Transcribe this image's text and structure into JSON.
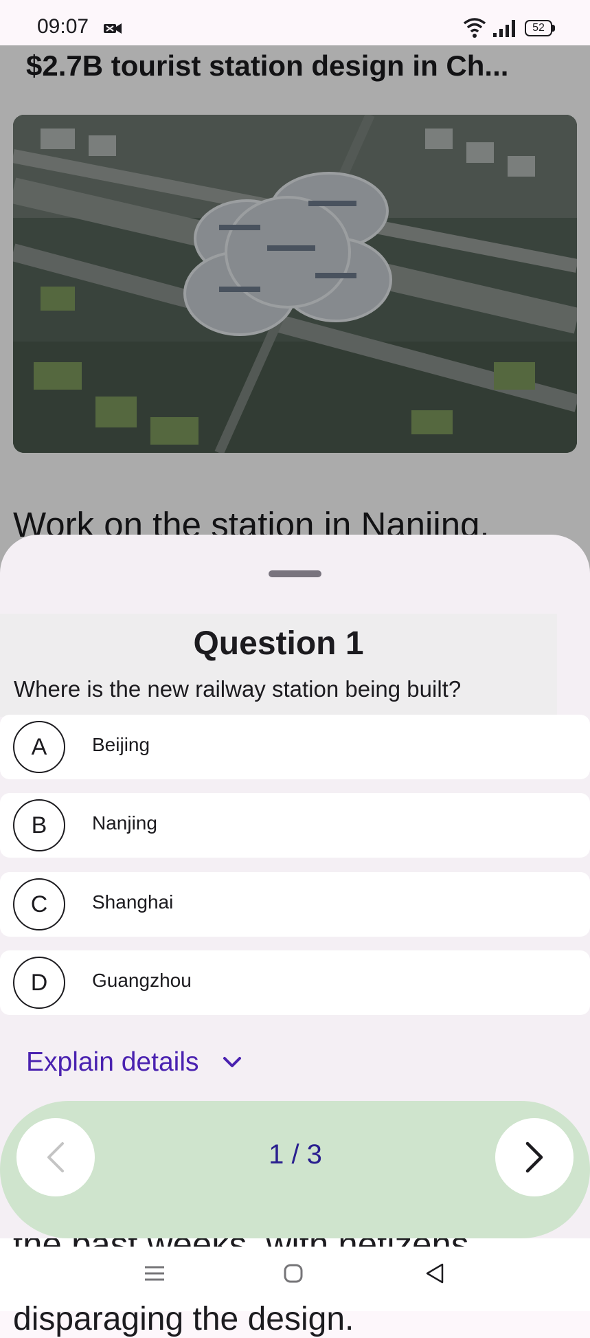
{
  "status_bar": {
    "time": "09:07",
    "battery": "52",
    "icons": [
      "notification-icon",
      "wifi-icon",
      "signal-icon",
      "battery-icon"
    ]
  },
  "article": {
    "title": "$2.7B tourist station design in Ch...",
    "body_visible": "Work on the station in Nanjing,",
    "tail_line_1": "the past weeks, with netizens",
    "tail_line_2": "disparaging the design."
  },
  "quiz": {
    "title": "Question 1",
    "question": "Where is the new railway station being built?",
    "options": [
      {
        "letter": "A",
        "label": "Beijing"
      },
      {
        "letter": "B",
        "label": "Nanjing"
      },
      {
        "letter": "C",
        "label": "Shanghai"
      },
      {
        "letter": "D",
        "label": "Guangzhou"
      }
    ],
    "explain_label": "Explain details",
    "pager": {
      "current": 1,
      "total": 3,
      "label": "1 / 3"
    }
  },
  "colors": {
    "accent": "#4a22b0",
    "pager_background": "#cfe4cd",
    "sheet_background": "#f4eff4",
    "pager_text": "#2a1f8f"
  }
}
